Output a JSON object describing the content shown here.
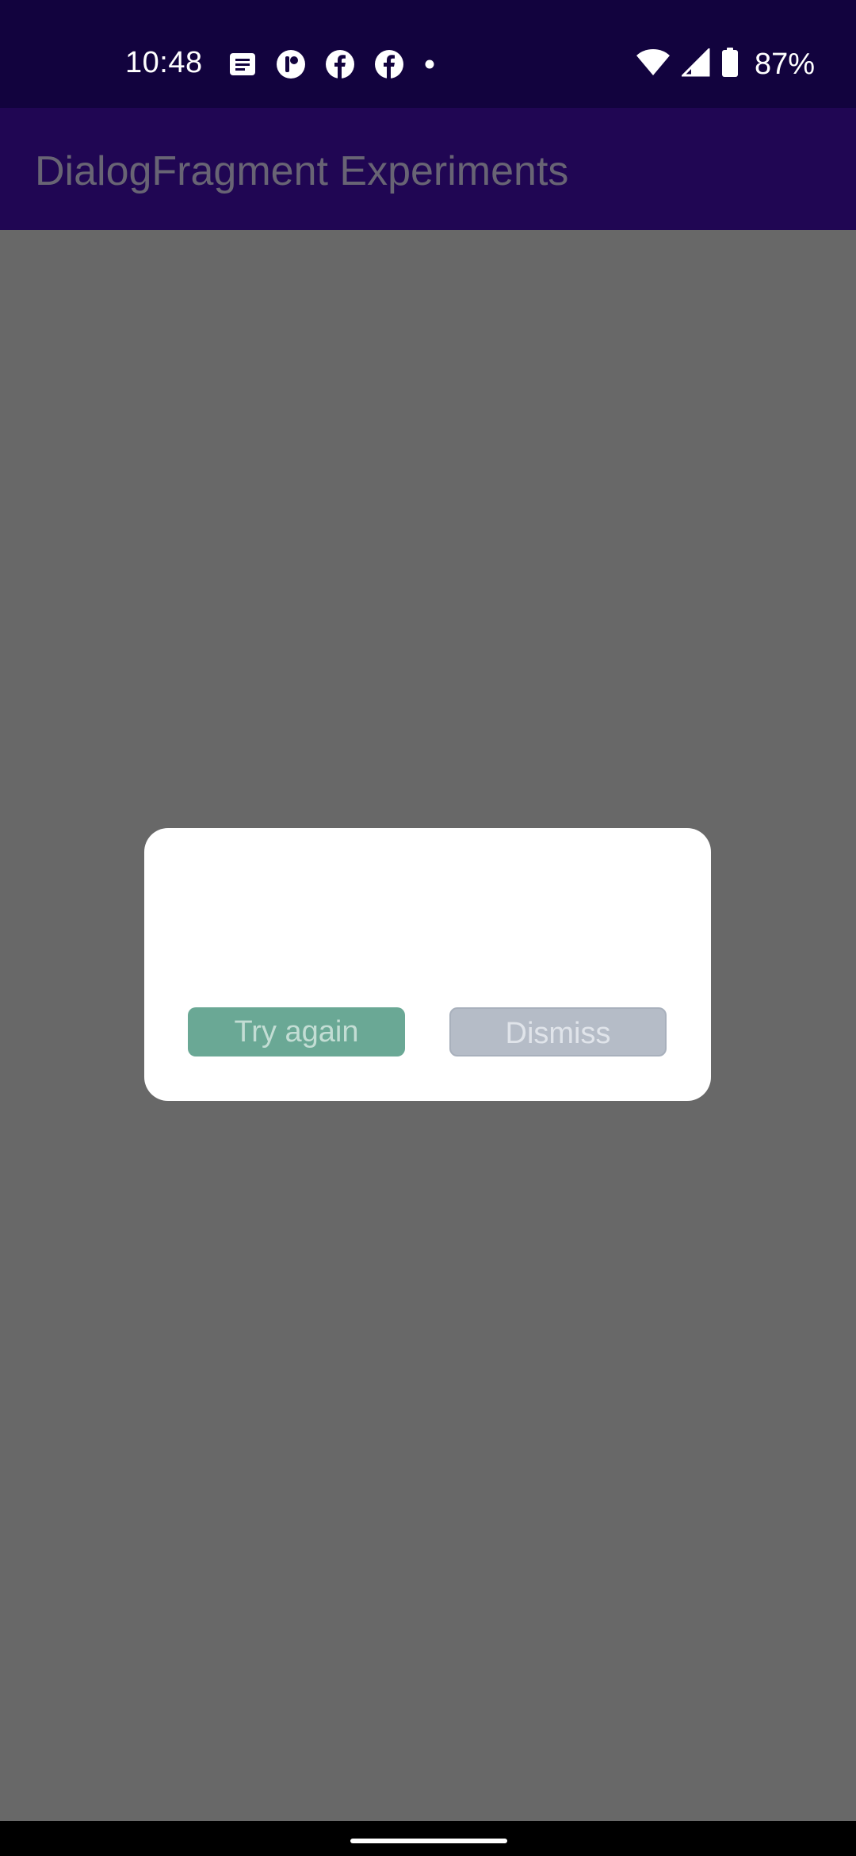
{
  "status_bar": {
    "time": "10:48",
    "notification_icons": [
      "messages-icon",
      "app-icon",
      "facebook-icon",
      "facebook-icon",
      "more-dot-icon"
    ],
    "battery_percent": "87%",
    "system_icons": [
      "wifi-icon",
      "cellular-signal-icon",
      "battery-icon"
    ]
  },
  "app_bar": {
    "title": "DialogFragment Experiments"
  },
  "dialog": {
    "try_again_label": "Try again",
    "dismiss_label": "Dismiss"
  },
  "colors": {
    "status_bar": "#12033e",
    "app_bar": "#200653",
    "scrim": "#686868",
    "try_again_button": "#6aa895",
    "dismiss_button": "#b5bcc7"
  }
}
